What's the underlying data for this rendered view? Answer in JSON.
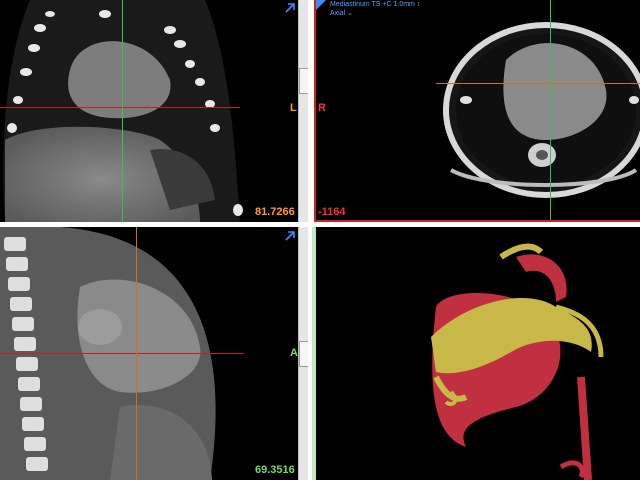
{
  "viewports": {
    "coronal": {
      "orient_left": "L",
      "window_value": "81.7266",
      "ct_value": "-1164",
      "expand_icon": "expand-arrow-icon"
    },
    "axial": {
      "series_line1": "Mediastinum TS +C 1.0mm",
      "series_line1_suffix": "↕",
      "series_line2": "Axial ⌄",
      "orient_right": "R"
    },
    "sagittal": {
      "orient_right": "A",
      "window_value": "69.3516",
      "expand_icon": "expand-arrow-icon"
    },
    "render3d": {}
  },
  "colors": {
    "divider": "#ffffff",
    "axial_frame": "#cc2222",
    "crosshair_red": "#c02020",
    "crosshair_green": "#40c040",
    "crosshair_orange": "#d07010",
    "value_orange": "#ff9a28",
    "value_red": "#ff3030",
    "value_green": "#7cd86a",
    "accent_blue": "#3c8cff",
    "vessel_yellow": "#c8b848",
    "vessel_red": "#c03040"
  }
}
